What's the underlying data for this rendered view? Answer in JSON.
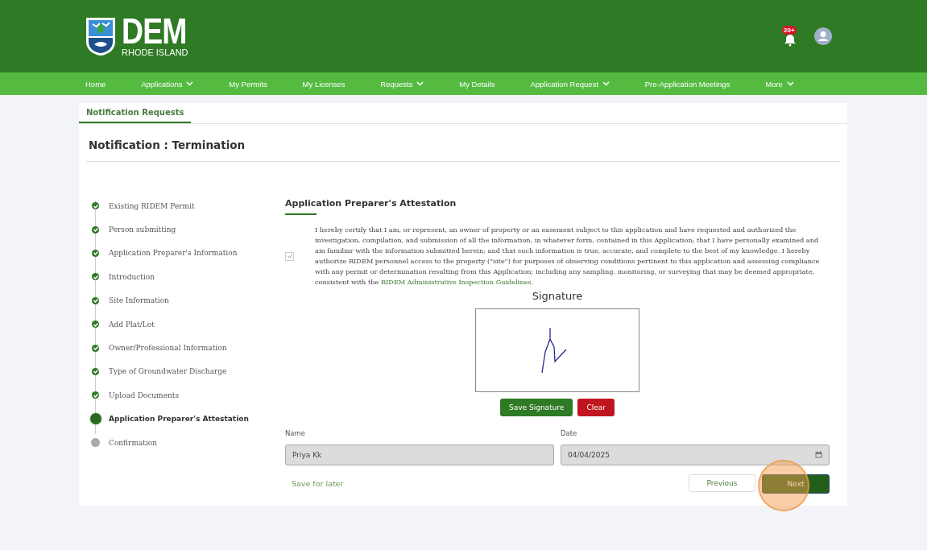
{
  "header": {
    "logo_title": "DEM",
    "logo_subtitle": "RHODE ISLAND",
    "notification_badge": "20+"
  },
  "nav": [
    {
      "label": "Home",
      "dropdown": false
    },
    {
      "label": "Applications",
      "dropdown": true
    },
    {
      "label": "My Permits",
      "dropdown": false
    },
    {
      "label": "My Licenses",
      "dropdown": false
    },
    {
      "label": "Requests",
      "dropdown": true
    },
    {
      "label": "My Details",
      "dropdown": false
    },
    {
      "label": "Application Request",
      "dropdown": true
    },
    {
      "label": "Pre-Application Meetings",
      "dropdown": false
    },
    {
      "label": "More",
      "dropdown": true
    }
  ],
  "tabs": [
    {
      "label": "Notification Requests",
      "selected": true
    }
  ],
  "page_title": "Notification : Termination",
  "steps": [
    {
      "label": "Existing RIDEM Permit",
      "kind": "complete"
    },
    {
      "label": "Person submitting",
      "kind": "complete"
    },
    {
      "label": "Application Preparer's Information",
      "kind": "complete"
    },
    {
      "label": "Introduction",
      "kind": "complete"
    },
    {
      "label": "Site Information",
      "kind": "complete"
    },
    {
      "label": "Add Plat/Lot",
      "kind": "complete"
    },
    {
      "label": "Owner/Professional Information",
      "kind": "complete"
    },
    {
      "label": "Type of Groundwater Discharge",
      "kind": "complete"
    },
    {
      "label": "Upload Documents",
      "kind": "complete"
    },
    {
      "label": "Application Preparer's Attestation",
      "kind": "current"
    },
    {
      "label": "Confirmation",
      "kind": "pending"
    }
  ],
  "section_title": "Application Preparer's Attestation",
  "attestation": {
    "checked": true,
    "text": "I hereby certify that I am, or represent, an owner of property or an easement subject to this application and have requested and authorized the investigation, compilation, and submission of all the information, in whatever form, contained in this Application; that I have personally examined and am familiar with the information submitted herein; and that such information is true, accurate, and complete to the best of my knowledge. I hereby authorize RIDEM personnel access to the property (\"site\") for purposes of observing conditions pertinent to this application and assessing compliance with any permit or determination resulting from this Application; including any sampling, monitoring, or surveying that may be deemed appropriate, consistent with the ",
    "link": "RIDEM Administrative Inspection Guidelines",
    "after_link": "."
  },
  "signature": {
    "label": "Signature",
    "save_button": "Save Signature",
    "clear_button": "Clear"
  },
  "fields": [
    {
      "label": "Name",
      "value": "Priya Kk",
      "kind": "text"
    },
    {
      "label": "Date",
      "value": "04/04/2025",
      "kind": "date"
    }
  ],
  "footer": {
    "save_link": "Save for later",
    "previous_button": "Previous",
    "next_button": "Next",
    "next_highlighted": true
  }
}
